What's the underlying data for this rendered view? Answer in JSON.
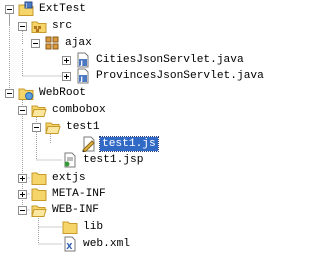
{
  "tree": {
    "project": {
      "label": "ExtTest",
      "icon": "project-icon"
    },
    "src": {
      "label": "src",
      "icon": "source-folder-icon"
    },
    "ajax": {
      "label": "ajax",
      "icon": "package-icon"
    },
    "cities": {
      "label": "CitiesJsonServlet.java",
      "icon": "java-file-icon"
    },
    "provinces": {
      "label": "ProvincesJsonServlet.java",
      "icon": "java-file-icon"
    },
    "webroot": {
      "label": "WebRoot",
      "icon": "web-folder-icon"
    },
    "combobox": {
      "label": "combobox",
      "icon": "folder-icon"
    },
    "test1_folder": {
      "label": "test1",
      "icon": "folder-icon"
    },
    "test1_js": {
      "label": "test1.js",
      "icon": "js-file-icon",
      "selected": true
    },
    "test1_jsp": {
      "label": "test1.jsp",
      "icon": "jsp-file-icon"
    },
    "extjs": {
      "label": "extjs",
      "icon": "folder-icon"
    },
    "meta_inf": {
      "label": "META-INF",
      "icon": "folder-icon"
    },
    "web_inf": {
      "label": "WEB-INF",
      "icon": "folder-icon"
    },
    "lib": {
      "label": "lib",
      "icon": "folder-icon"
    },
    "web_xml": {
      "label": "web.xml",
      "icon": "xml-file-icon"
    }
  },
  "colors": {
    "selection": "#316ac5",
    "folder": "#f5d46a",
    "folder_edge": "#c79a2a"
  }
}
